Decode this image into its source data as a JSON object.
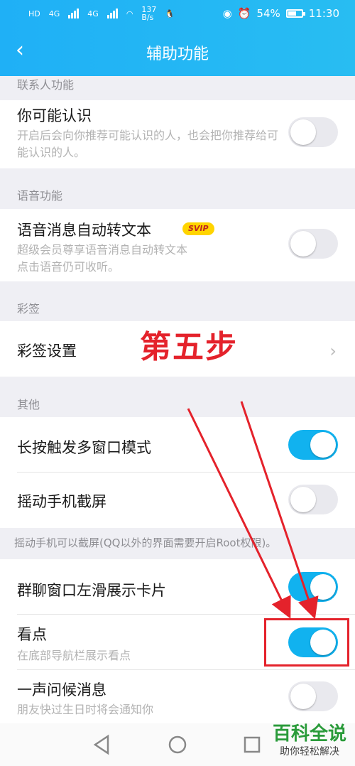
{
  "status_bar": {
    "network_1": "HD",
    "network_2": "HD",
    "sig1": "4G",
    "sig2": "4G",
    "speed": "137",
    "speed_unit": "B/s",
    "battery": "54%",
    "time": "11:30"
  },
  "header": {
    "title": "辅助功能",
    "back_icon": "chevron-left-icon"
  },
  "sections": {
    "contacts": "联系人功能",
    "voice": "语音功能",
    "caiqian": "彩签",
    "other": "其他"
  },
  "rows": {
    "maybe_know": {
      "title": "你可能认识",
      "desc": "开启后会向你推荐可能认识的人，也会把你推荐给可能认识的人。",
      "on": false
    },
    "voice_to_text": {
      "title": "语音消息自动转文本",
      "badge": "SVIP",
      "desc1": "超级会员尊享语音消息自动转文本",
      "desc2": "点击语音仍可收听。",
      "on": false
    },
    "caiqian_settings": {
      "title": "彩签设置"
    },
    "multi_window": {
      "title": "长按触发多窗口模式",
      "on": true
    },
    "shake_screenshot": {
      "title": "摇动手机截屏",
      "on": false
    },
    "shake_note": "摇动手机可以截屏(QQ以外的界面需要开启Root权限)。",
    "group_card": {
      "title": "群聊窗口左滑展示卡片",
      "on": true
    },
    "kandian": {
      "title": "看点",
      "desc": "在底部导航栏展示看点",
      "on": true
    },
    "greeting": {
      "title": "一声问候消息",
      "desc": "朋友快过生日时将会通知你",
      "on": false
    }
  },
  "annotation": {
    "step_text": "第五步"
  },
  "watermark": {
    "title": "百科全说",
    "subtitle": "助你轻松解决"
  },
  "colors": {
    "accent": "#11b2ef",
    "annotation": "#e4222b",
    "header": "#1fb0f6"
  }
}
